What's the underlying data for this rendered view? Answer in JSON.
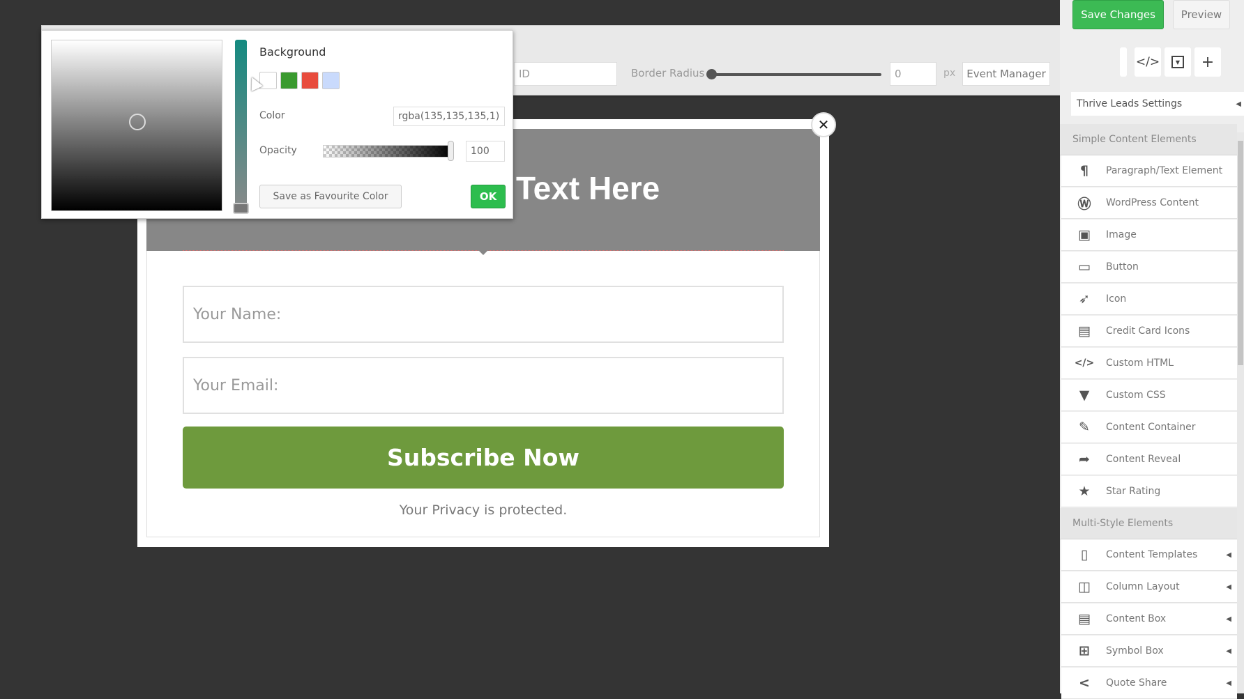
{
  "top": {
    "save_label": "Save Changes",
    "preview_label": "Preview"
  },
  "toolbar": {
    "id_placeholder": "ID",
    "border_radius_label": "Border Radius",
    "border_radius_value": "0",
    "border_radius_unit": "px",
    "border_radius_slider": 0,
    "event_manager_label": "Event Manager"
  },
  "sidebar": {
    "settings_label": "Thrive Leads Settings",
    "simple_header": "Simple Content Elements",
    "simple_items": [
      {
        "label": "Paragraph/Text Element",
        "icon": "paragraph-icon"
      },
      {
        "label": "WordPress Content",
        "icon": "wordpress-icon"
      },
      {
        "label": "Image",
        "icon": "image-icon"
      },
      {
        "label": "Button",
        "icon": "button-icon"
      },
      {
        "label": "Icon",
        "icon": "rocket-icon"
      },
      {
        "label": "Credit Card Icons",
        "icon": "credit-card-icon"
      },
      {
        "label": "Custom HTML",
        "icon": "code-icon"
      },
      {
        "label": "Custom CSS",
        "icon": "css-icon"
      },
      {
        "label": "Content Container",
        "icon": "edit-icon"
      },
      {
        "label": "Content Reveal",
        "icon": "share-arrow-icon"
      },
      {
        "label": "Star Rating",
        "icon": "star-icon"
      }
    ],
    "multi_header": "Multi-Style Elements",
    "multi_items": [
      {
        "label": "Content Templates",
        "icon": "document-icon"
      },
      {
        "label": "Column Layout",
        "icon": "columns-icon"
      },
      {
        "label": "Content Box",
        "icon": "content-box-icon"
      },
      {
        "label": "Symbol Box",
        "icon": "symbol-box-icon"
      },
      {
        "label": "Quote Share",
        "icon": "share-icon"
      }
    ]
  },
  "form": {
    "headline": "Text Here",
    "name_placeholder": "Your Name:",
    "email_placeholder": "Your Email:",
    "subscribe_label": "Subscribe Now",
    "privacy": "Your Privacy is protected.",
    "header_color": "#878787",
    "button_color": "#6e9a3d"
  },
  "picker": {
    "title": "Background",
    "swatches": [
      "#ffffff",
      "#3a9a2f",
      "#e84c3d",
      "#c9dafc"
    ],
    "color_label": "Color",
    "color_value": "rgba(135,135,135,1)",
    "opacity_label": "Opacity",
    "opacity_value": "100",
    "save_fav_label": "Save as Favourite Color",
    "ok_label": "OK"
  }
}
